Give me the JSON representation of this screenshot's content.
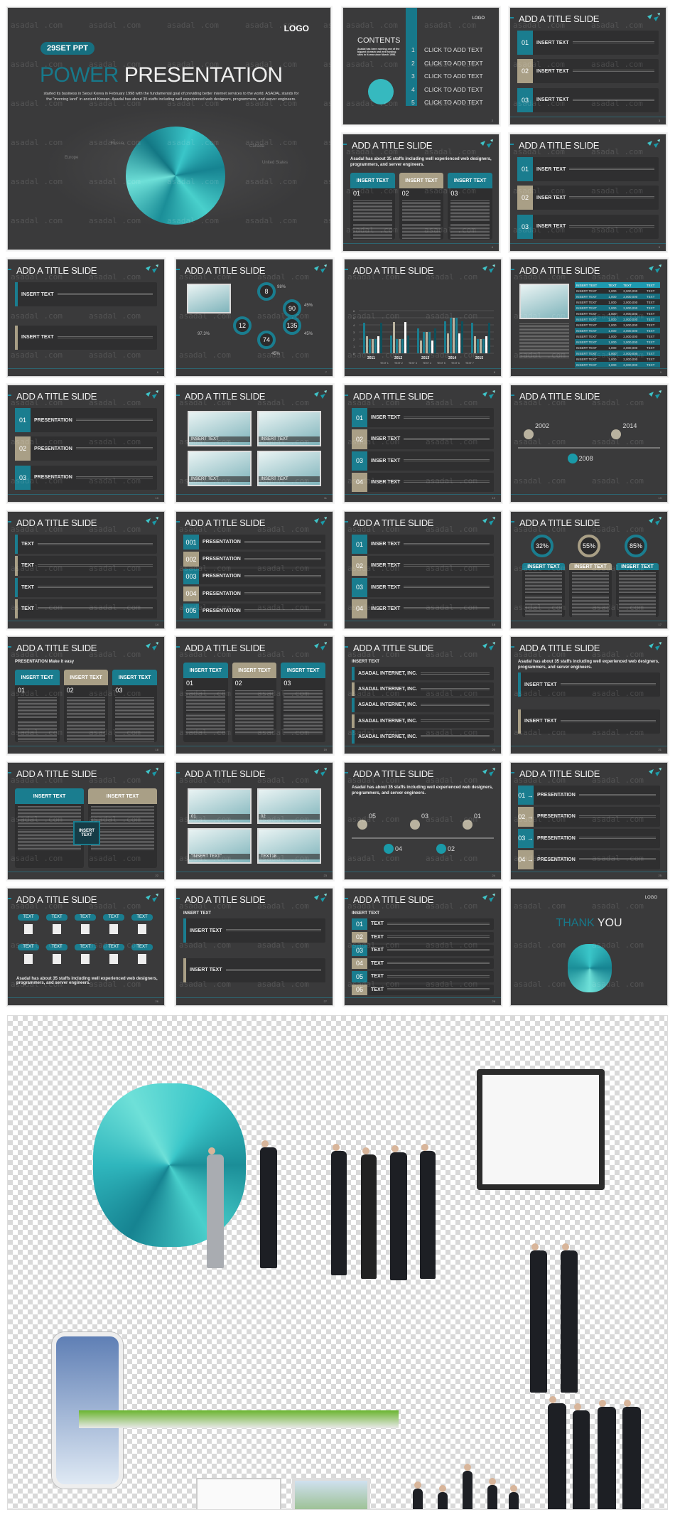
{
  "watermark": "asadal .com",
  "colors": {
    "background": "#3a3a3b",
    "accent": "#1a7d8f",
    "secondary": "#a99f86"
  },
  "cover": {
    "logo": "LOGO",
    "badge": "29SET PPT",
    "title_accent": "POWER",
    "title_main": "PRESENTATION",
    "description": "started its business in Seoul Korea in February 1998 with the fundamental goal of providing better internet services to the world. ASADAL stands for the \"morning land\" in ancient Korean. Asadal has about 35 staffs including well experienced web designers, programmers, and server engineers.",
    "map_labels": [
      "Russia",
      "Europe",
      "Canada",
      "United States"
    ]
  },
  "contents": {
    "logo": "LOGO",
    "title": "CONTENTS",
    "intro": "Asadal has been running one of the biggest domain and web hosting sites in Korea since March 1998.",
    "items": [
      {
        "num": "1",
        "label": "CLICK TO ADD TEXT"
      },
      {
        "num": "2",
        "label": "CLICK TO ADD TEXT"
      },
      {
        "num": "3",
        "label": "CLICK TO ADD TEXT"
      },
      {
        "num": "4",
        "label": "CLICK TO ADD TEXT"
      },
      {
        "num": "5",
        "label": "CLICK TO ADD TEXT"
      }
    ],
    "page": "2"
  },
  "slides": [
    {
      "layout": "rows",
      "title": "ADD A TITLE SLIDE",
      "page": "3",
      "items": [
        {
          "num": "01",
          "label": "INSERT TEXT"
        },
        {
          "num": "02",
          "label": "INSERT TEXT"
        },
        {
          "num": "03",
          "label": "INSERT TEXT"
        }
      ]
    },
    {
      "layout": "cols",
      "title": "ADD A TITLE SLIDE",
      "page": "4",
      "heading": "Asadal has about 35 staffs including well experienced web designers, programmers, and server engineers.",
      "items": [
        {
          "num": "01",
          "label": "INSERT TEXT"
        },
        {
          "num": "02",
          "label": "INSERT TEXT"
        },
        {
          "num": "03",
          "label": "INSERT TEXT"
        }
      ]
    },
    {
      "layout": "rows",
      "title": "ADD A TITLE SLIDE",
      "page": "5",
      "items": [
        {
          "num": "01",
          "label": "INSER TEXT"
        },
        {
          "num": "02",
          "label": "INSER TEXT"
        },
        {
          "num": "03",
          "label": "INSER TEXT"
        }
      ]
    },
    {
      "layout": "rows",
      "title": "ADD A TITLE SLIDE",
      "page": "6",
      "items": [
        {
          "num": "",
          "label": "INSERT TEXT"
        },
        {
          "num": "",
          "label": "INSERT TEXT"
        }
      ]
    },
    {
      "layout": "circles",
      "title": "ADD A TITLE SLIDE",
      "page": "7",
      "items": [
        {
          "label": "8"
        },
        {
          "label": "90"
        },
        {
          "label": "12"
        },
        {
          "label": "135"
        },
        {
          "label": "74"
        }
      ],
      "notes": [
        "98%",
        "45%",
        "97.3%",
        "45%",
        "45%"
      ]
    },
    {
      "layout": "chart",
      "title": "ADD A TITLE SLIDE",
      "page": "8",
      "chart": {
        "categories": [
          "2011",
          "2012",
          "2013",
          "2014",
          "2015"
        ],
        "yticks": [
          "0",
          "1",
          "2",
          "3",
          "4",
          "5",
          "6"
        ],
        "ylim": [
          0,
          6
        ],
        "series": [
          {
            "name": "TEXT 1",
            "values": [
              4.3,
              2.5,
              3.5,
              4.5,
              4.3
            ]
          },
          {
            "name": "TEXT 2",
            "values": [
              2.4,
              4.4,
              1.8,
              2.8,
              2.4
            ]
          },
          {
            "name": "TEXT 3",
            "values": [
              2,
              2,
              3,
              5,
              2
            ]
          },
          {
            "name": "TEXT 4",
            "values": [
              2,
              2,
              3,
              5,
              2
            ]
          },
          {
            "name": "TEXT 5",
            "values": [
              2,
              2,
              3,
              5,
              2
            ]
          },
          {
            "name": "TEXT 6",
            "values": [
              2.4,
              4.4,
              1.8,
              2.8,
              2.4
            ]
          },
          {
            "name": "TEXT 7",
            "values": [
              4.3,
              2.5,
              3.5,
              4.5,
              4.3
            ]
          }
        ]
      }
    },
    {
      "layout": "table",
      "title": "ADD A TITLE SLIDE",
      "page": "9",
      "header": [
        "INSERT TEXT",
        "TEXT",
        "TEXT",
        "TEXT"
      ],
      "row": [
        "INSERT TEXT",
        "1,000",
        "2,000,000",
        "TEXT"
      ],
      "rows": 14
    },
    {
      "layout": "rows",
      "title": "ADD A TITLE SLIDE",
      "page": "10",
      "items": [
        {
          "num": "01",
          "label": "PRESENTATION"
        },
        {
          "num": "02",
          "label": "PRESENTATION"
        },
        {
          "num": "03",
          "label": "PRESENTATION"
        }
      ]
    },
    {
      "layout": "images",
      "title": "ADD A TITLE SLIDE",
      "page": "11",
      "items": [
        {
          "label": "INSERT TEXT"
        },
        {
          "label": "INSERT TEXT"
        },
        {
          "label": "INSERT TEXT"
        },
        {
          "label": "INSERT TEXT"
        }
      ]
    },
    {
      "layout": "rows",
      "title": "ADD A TITLE SLIDE",
      "page": "12",
      "items": [
        {
          "num": "01",
          "label": "INSER TEXT"
        },
        {
          "num": "02",
          "label": "INSER TEXT"
        },
        {
          "num": "03",
          "label": "INSER TEXT"
        },
        {
          "num": "04",
          "label": "INSER TEXT"
        }
      ]
    },
    {
      "layout": "timeline",
      "title": "ADD A TITLE SLIDE",
      "page": "13",
      "items": [
        {
          "label": "2002"
        },
        {
          "label": "2008"
        },
        {
          "label": "2014"
        }
      ]
    },
    {
      "layout": "rows",
      "title": "ADD A TITLE SLIDE",
      "page": "14",
      "items": [
        {
          "num": "",
          "label": "TEXT"
        },
        {
          "num": "",
          "label": "TEXT"
        },
        {
          "num": "",
          "label": "TEXT"
        },
        {
          "num": "",
          "label": "TEXT"
        }
      ]
    },
    {
      "layout": "rows",
      "title": "ADD A TITLE SLIDE",
      "page": "15",
      "items": [
        {
          "num": "001",
          "label": "PRESENTATION"
        },
        {
          "num": "002",
          "label": "PRESENTATION"
        },
        {
          "num": "003",
          "label": "PRESENTATION"
        },
        {
          "num": "004",
          "label": "PRESENTATION"
        },
        {
          "num": "005",
          "label": "PRESENTATION"
        }
      ]
    },
    {
      "layout": "rows",
      "title": "ADD A TITLE SLIDE",
      "page": "16",
      "items": [
        {
          "num": "01",
          "label": "INSER TEXT"
        },
        {
          "num": "02",
          "label": "INSER TEXT"
        },
        {
          "num": "03",
          "label": "INSER TEXT"
        },
        {
          "num": "04",
          "label": "INSER TEXT"
        }
      ]
    },
    {
      "layout": "percent",
      "title": "ADD A TITLE SLIDE",
      "page": "17",
      "items": [
        {
          "label": "32%"
        },
        {
          "label": "55%"
        },
        {
          "label": "85%"
        }
      ],
      "caption": "INSERT TEXT"
    },
    {
      "layout": "cols",
      "title": "ADD A TITLE SLIDE",
      "page": "18",
      "heading": "PRESENTATION Make it easy",
      "items": [
        {
          "num": "01",
          "label": "INSERT TEXT"
        },
        {
          "num": "02",
          "label": "INSERT TEXT"
        },
        {
          "num": "03",
          "label": "INSERT TEXT"
        }
      ]
    },
    {
      "layout": "cols",
      "title": "ADD A TITLE SLIDE",
      "page": "19",
      "items": [
        {
          "num": "01",
          "label": "INSERT TEXT"
        },
        {
          "num": "02",
          "label": "INSERT TEXT"
        },
        {
          "num": "03",
          "label": "INSERT TEXT"
        }
      ]
    },
    {
      "layout": "rows",
      "title": "ADD A TITLE SLIDE",
      "page": "20",
      "heading": "INSERT TEXT",
      "items": [
        {
          "num": "",
          "label": "ASADAL INTERNET, INC."
        },
        {
          "num": "",
          "label": "ASADAL INTERNET, INC."
        },
        {
          "num": "",
          "label": "ASADAL INTERNET, INC."
        },
        {
          "num": "",
          "label": "ASADAL INTERNET, INC."
        },
        {
          "num": "",
          "label": "ASADAL INTERNET, INC."
        }
      ]
    },
    {
      "layout": "rows",
      "title": "ADD A TITLE SLIDE",
      "page": "21",
      "heading": "Asadal has about 35 staffs including well experienced web designers, programmers, and server engineers.",
      "items": [
        {
          "num": "",
          "label": "INSERT TEXT"
        },
        {
          "num": "",
          "label": "INSERT TEXT"
        }
      ]
    },
    {
      "layout": "cols",
      "title": "ADD A TITLE SLIDE",
      "page": "22",
      "items": [
        {
          "num": "",
          "label": "INSERT TEXT"
        },
        {
          "num": "",
          "label": "INSERT TEXT"
        }
      ],
      "center": "INSERT TEXT"
    },
    {
      "layout": "images",
      "title": "ADD A TITLE SLIDE",
      "page": "23",
      "items": [
        {
          "label": "01"
        },
        {
          "label": "02"
        },
        {
          "label": "\"INSERT TEXT\""
        },
        {
          "label": "TEXT18"
        }
      ]
    },
    {
      "layout": "timeline",
      "title": "ADD A TITLE SLIDE",
      "page": "24",
      "heading": "Asadal has about 35 staffs including well experienced web designers, programmers, and server engineers.",
      "items": [
        {
          "label": "05"
        },
        {
          "label": "04"
        },
        {
          "label": "03"
        },
        {
          "label": "02"
        },
        {
          "label": "01"
        }
      ]
    },
    {
      "layout": "rows",
      "title": "ADD A TITLE SLIDE",
      "page": "25",
      "items": [
        {
          "num": "01 →",
          "label": "PRESENTATION"
        },
        {
          "num": "02 →",
          "label": "PRESENTATION"
        },
        {
          "num": "03 →",
          "label": "PRESENTATION"
        },
        {
          "num": "04 →",
          "label": "PRESENTATION"
        }
      ]
    },
    {
      "layout": "grid10",
      "title": "ADD A TITLE SLIDE",
      "page": "26",
      "pill": "TEXT",
      "heading": "Asadal has about 35 staffs including well experienced web designers, programmers, and server engineers."
    },
    {
      "layout": "rows",
      "title": "ADD A TITLE SLIDE",
      "page": "27",
      "heading": "INSERT TEXT",
      "items": [
        {
          "num": "",
          "label": "INSERT TEXT"
        },
        {
          "num": "",
          "label": "INSERT TEXT"
        }
      ]
    },
    {
      "layout": "rows",
      "title": "ADD A TITLE SLIDE",
      "page": "28",
      "heading": "INSERT TEXT",
      "items": [
        {
          "num": "01",
          "label": "TEXT"
        },
        {
          "num": "02",
          "label": "TEXT"
        },
        {
          "num": "03",
          "label": "TEXT"
        },
        {
          "num": "04",
          "label": "TEXT"
        },
        {
          "num": "05",
          "label": "TEXT"
        },
        {
          "num": "06",
          "label": "TEXT"
        }
      ]
    },
    {
      "layout": "thanks",
      "title": "",
      "logo": "LOGO",
      "accent": "THANK",
      "main": "YOU"
    }
  ]
}
